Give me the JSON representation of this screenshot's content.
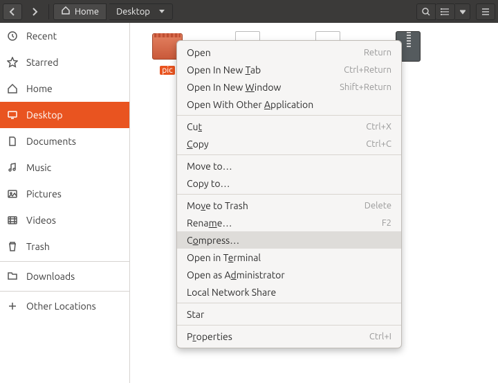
{
  "toolbar": {
    "breadcrumb": [
      "Home",
      "Desktop"
    ]
  },
  "sidebar": {
    "items": [
      {
        "id": "recent",
        "label": "Recent"
      },
      {
        "id": "starred",
        "label": "Starred"
      },
      {
        "id": "home",
        "label": "Home"
      },
      {
        "id": "desktop",
        "label": "Desktop"
      },
      {
        "id": "documents",
        "label": "Documents"
      },
      {
        "id": "music",
        "label": "Music"
      },
      {
        "id": "pictures",
        "label": "Pictures"
      },
      {
        "id": "videos",
        "label": "Videos"
      },
      {
        "id": "trash",
        "label": "Trash"
      }
    ],
    "downloads": "Downloads",
    "other": "Other Locations"
  },
  "files": {
    "selected": "pic"
  },
  "ctx": {
    "open": "Open",
    "open_sc": "Return",
    "open_tab": "Open In New Tab",
    "open_tab_sc": "Ctrl+Return",
    "open_win": "Open In New Window",
    "open_win_sc": "Shift+Return",
    "open_with": "Open With Other Application",
    "cut": "Cut",
    "cut_sc": "Ctrl+X",
    "copy": "Copy",
    "copy_sc": "Ctrl+C",
    "move_to": "Move to…",
    "copy_to": "Copy to…",
    "trash": "Move to Trash",
    "trash_sc": "Delete",
    "rename": "Rename…",
    "rename_sc": "F2",
    "compress": "Compress…",
    "terminal": "Open in Terminal",
    "admin": "Open as Administrator",
    "lns": "Local Network Share",
    "star": "Star",
    "props": "Properties",
    "props_sc": "Ctrl+I"
  }
}
